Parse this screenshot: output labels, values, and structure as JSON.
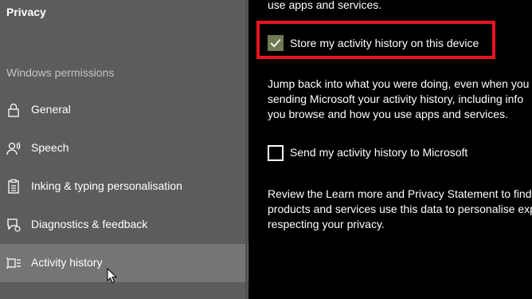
{
  "sidebar": {
    "title": "Privacy",
    "section_label": "Windows permissions",
    "items": [
      {
        "label": "General",
        "icon": "lock-icon"
      },
      {
        "label": "Speech",
        "icon": "speech-icon"
      },
      {
        "label": "Inking & typing personalisation",
        "icon": "clipboard-icon"
      },
      {
        "label": "Diagnostics & feedback",
        "icon": "feedback-icon"
      },
      {
        "label": "Activity history",
        "icon": "timeline-icon",
        "selected": true
      }
    ]
  },
  "content": {
    "top_cut_text": "use apps and services.",
    "store_activity": {
      "label": "Store my activity history on this device",
      "checked": true
    },
    "paragraph1": [
      "Jump back into what you were doing, even when you",
      "sending Microsoft your activity history, including info",
      "you browse and how you use apps and services."
    ],
    "send_activity": {
      "label": "Send my activity history to Microsoft",
      "checked": false
    },
    "paragraph2": [
      "Review the Learn more and Privacy Statement to find o",
      "products and services use this data to personalise exp",
      "respecting your privacy."
    ]
  },
  "colors": {
    "sidebar_bg": "#5c5c5c",
    "selected_bg": "#757575",
    "checkbox_checked": "#6f7a52",
    "highlight_border": "#e5141f"
  }
}
